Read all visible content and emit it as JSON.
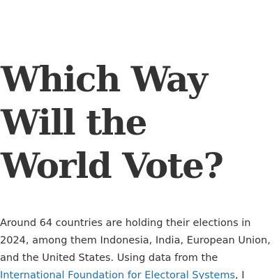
{
  "headline": {
    "lines": [
      "Which Way",
      "Will the",
      "World Vote?"
    ]
  },
  "intro": {
    "line1": "Around 64 countries are holding their elections in",
    "line2": "2024, among them Indonesia, India, European Union,",
    "line3": "and the United States. Using data from the",
    "link_text": "International Foundation for Electoral Systems",
    "after_link": ", I"
  },
  "colors": {
    "text": "#333333",
    "link": "#1f6fb5",
    "background": "#ffffff"
  }
}
